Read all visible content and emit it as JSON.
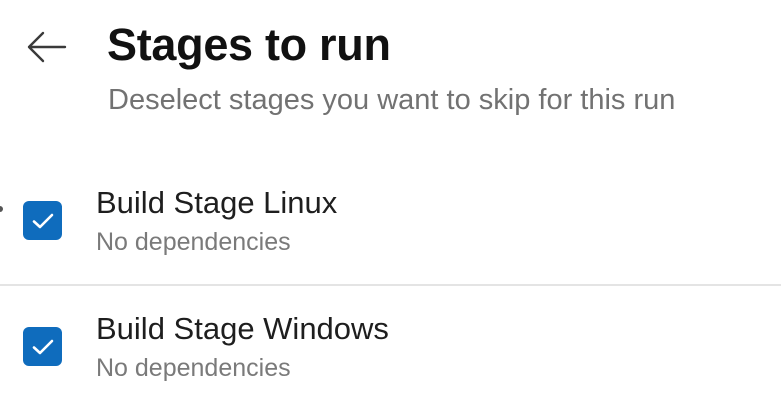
{
  "header": {
    "title": "Stages to run",
    "subtitle": "Deselect stages you want to skip for this run",
    "back_icon": "arrow-left-icon"
  },
  "stages": [
    {
      "name": "Build Stage Linux",
      "dependencies": "No dependencies",
      "checked": true,
      "check_icon": "checkmark-icon"
    },
    {
      "name": "Build Stage Windows",
      "dependencies": "No dependencies",
      "checked": true,
      "check_icon": "checkmark-icon"
    }
  ],
  "colors": {
    "accent": "#0f6cbd",
    "title": "#111111",
    "secondary_text": "#727272",
    "divider": "#e4e4e4"
  }
}
